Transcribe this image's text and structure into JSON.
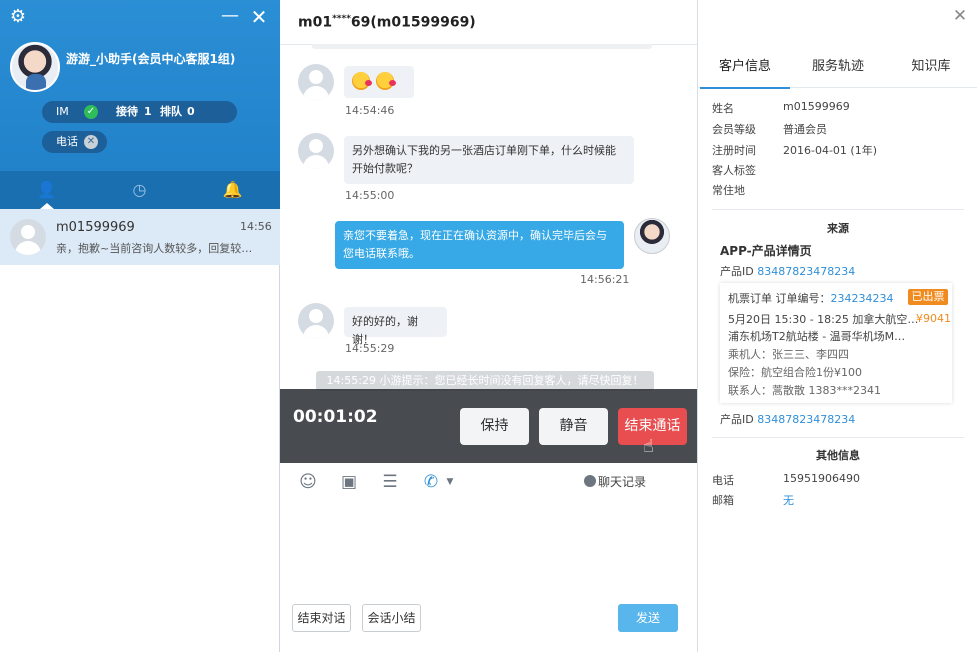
{
  "left": {
    "user_name": "游游_小助手(会员中心客服1组)",
    "im_label": "IM",
    "reception_label": "接待",
    "reception_count": "1",
    "queue_label": "排队",
    "queue_count": "0",
    "phone_label": "电话",
    "conversations": [
      {
        "name": "m01599969",
        "time": "14:56",
        "message": "亲，抱歉~当前咨询人数较多，回复较…"
      }
    ]
  },
  "chat": {
    "title_prefix": "m01",
    "title_mask": "****",
    "title_suffix": "69(m01599969)",
    "messages": [
      {
        "time": "14:54:46"
      },
      {
        "text": "另外想确认下我的另一张酒店订单刚下单，什么时候能开始付款呢？",
        "time": "14:55:00"
      },
      {
        "text": "亲您不要着急，现在正在确认资源中，确认完毕后会与您电话联系哦。",
        "time": "14:56:21"
      },
      {
        "text": "好的好的，谢谢！",
        "time": "14:55:29"
      }
    ],
    "system_note": "14:55:29  小游提示：您已经长时间没有回复客人，请尽快回复！",
    "call": {
      "duration": "00:01:02",
      "hold_label": "保持",
      "mute_label": "静音",
      "end_call_label": "结束通话"
    },
    "history_label": "聊天记录",
    "end_dialog_label": "结束对话",
    "summary_label": "会话小结",
    "send_label": "发送"
  },
  "right": {
    "tabs": [
      "客户信息",
      "服务轨迹",
      "知识库"
    ],
    "fields": [
      {
        "key": "姓名",
        "value": "m01599969"
      },
      {
        "key": "会员等级",
        "value": "普通会员"
      },
      {
        "key": "注册时间",
        "value": "2016-04-01 (1年)"
      },
      {
        "key": "客人标签",
        "value": ""
      },
      {
        "key": "常住地",
        "value": ""
      }
    ],
    "source_title": "来源",
    "product_title": "APP-产品详情页",
    "product_id_label": "产品ID",
    "product_id": "83487823478234",
    "order": {
      "title": "机票订单 订单编号：",
      "order_no": "234234234",
      "status": "已出票",
      "line1": "5月20日 15:30 - 18:25 加拿大航空…",
      "price": "¥9041",
      "line2": "浦东机场T2航站楼 - 温哥华机场M…",
      "line3": "乘机人：张三三、李四四",
      "line4": "保险：航空组合险1份¥100",
      "line5": "联系人：蒿散散 1383***2341"
    },
    "product_id2": "83487823478234",
    "other_title": "其他信息",
    "phone_label": "电话",
    "phone": "15951906490",
    "email_label": "邮箱",
    "email": "无"
  },
  "colors": {
    "brand_blue": "#2b8fd6",
    "send_blue": "#58b6ec",
    "end_call_red": "#e84d4f",
    "badge_orange": "#f08b1f"
  }
}
